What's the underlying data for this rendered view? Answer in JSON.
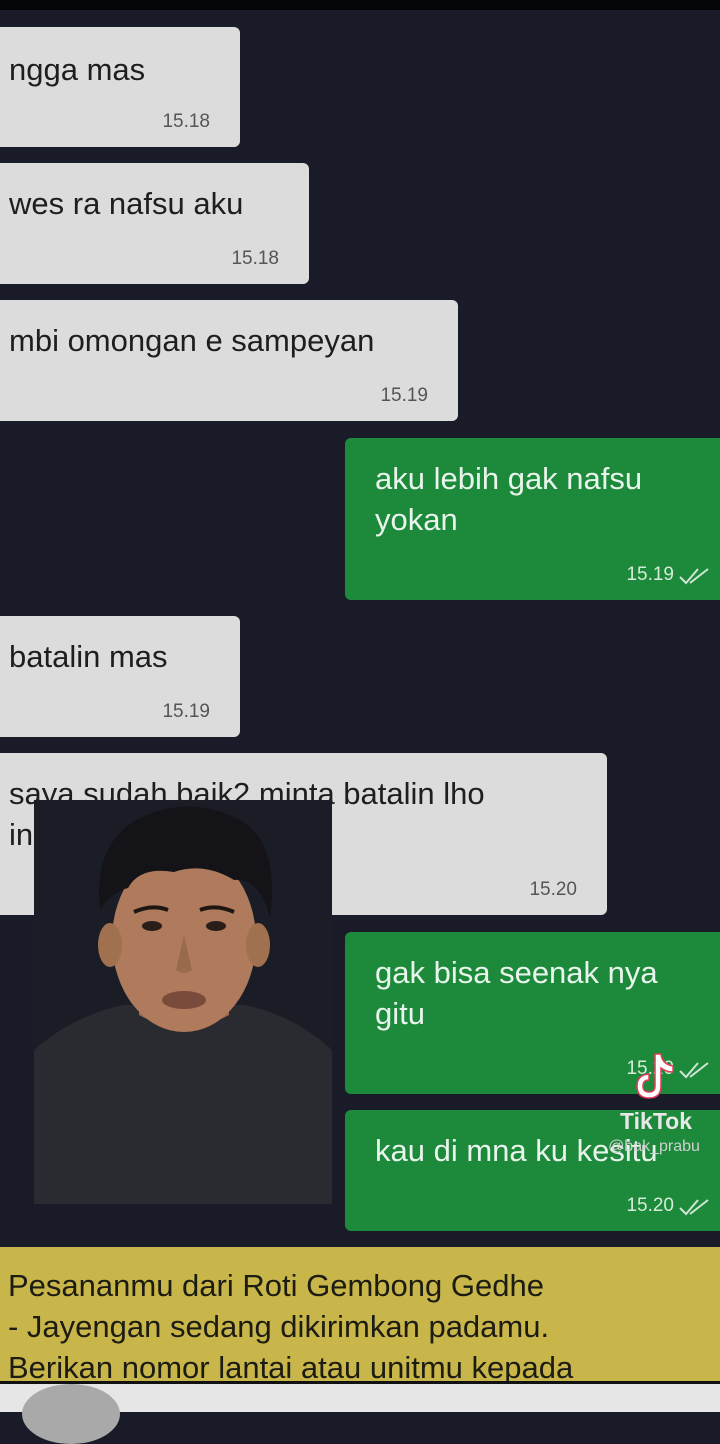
{
  "messages": [
    {
      "text": "ngga mas",
      "time": "15.18",
      "dir": "in"
    },
    {
      "text": "wes ra nafsu aku",
      "time": "15.18",
      "dir": "in"
    },
    {
      "text": "mbi omongan e sampeyan",
      "time": "15.19",
      "dir": "in"
    },
    {
      "text": "aku lebih gak nafsu\nyokan",
      "time": "15.19",
      "dir": "out"
    },
    {
      "text": "batalin mas",
      "time": "15.19",
      "dir": "in"
    },
    {
      "text": "saya sudah baik2 minta batalin lho\nini",
      "time": "15.20",
      "dir": "in"
    },
    {
      "text": "gak bisa seenak nya\ngitu",
      "time": "15.20",
      "dir": "out"
    },
    {
      "text": "kau di mna ku kesitu",
      "time": "15.20",
      "dir": "out"
    }
  ],
  "promo": {
    "line1": "Pesananmu dari Roti Gembong Gedhe",
    "line2": "- Jayengan sedang dikirimkan padamu.",
    "line3": "Berikan nomor lantai atau unitmu kepada"
  },
  "watermark": {
    "brand": "TikTok",
    "handle": "@bak_prabu"
  },
  "colors": {
    "background": "#191c28",
    "incoming_bubble": "#dcdcdc",
    "outgoing_bubble": "#1c8a3a",
    "promo_banner": "#c8b64b"
  }
}
